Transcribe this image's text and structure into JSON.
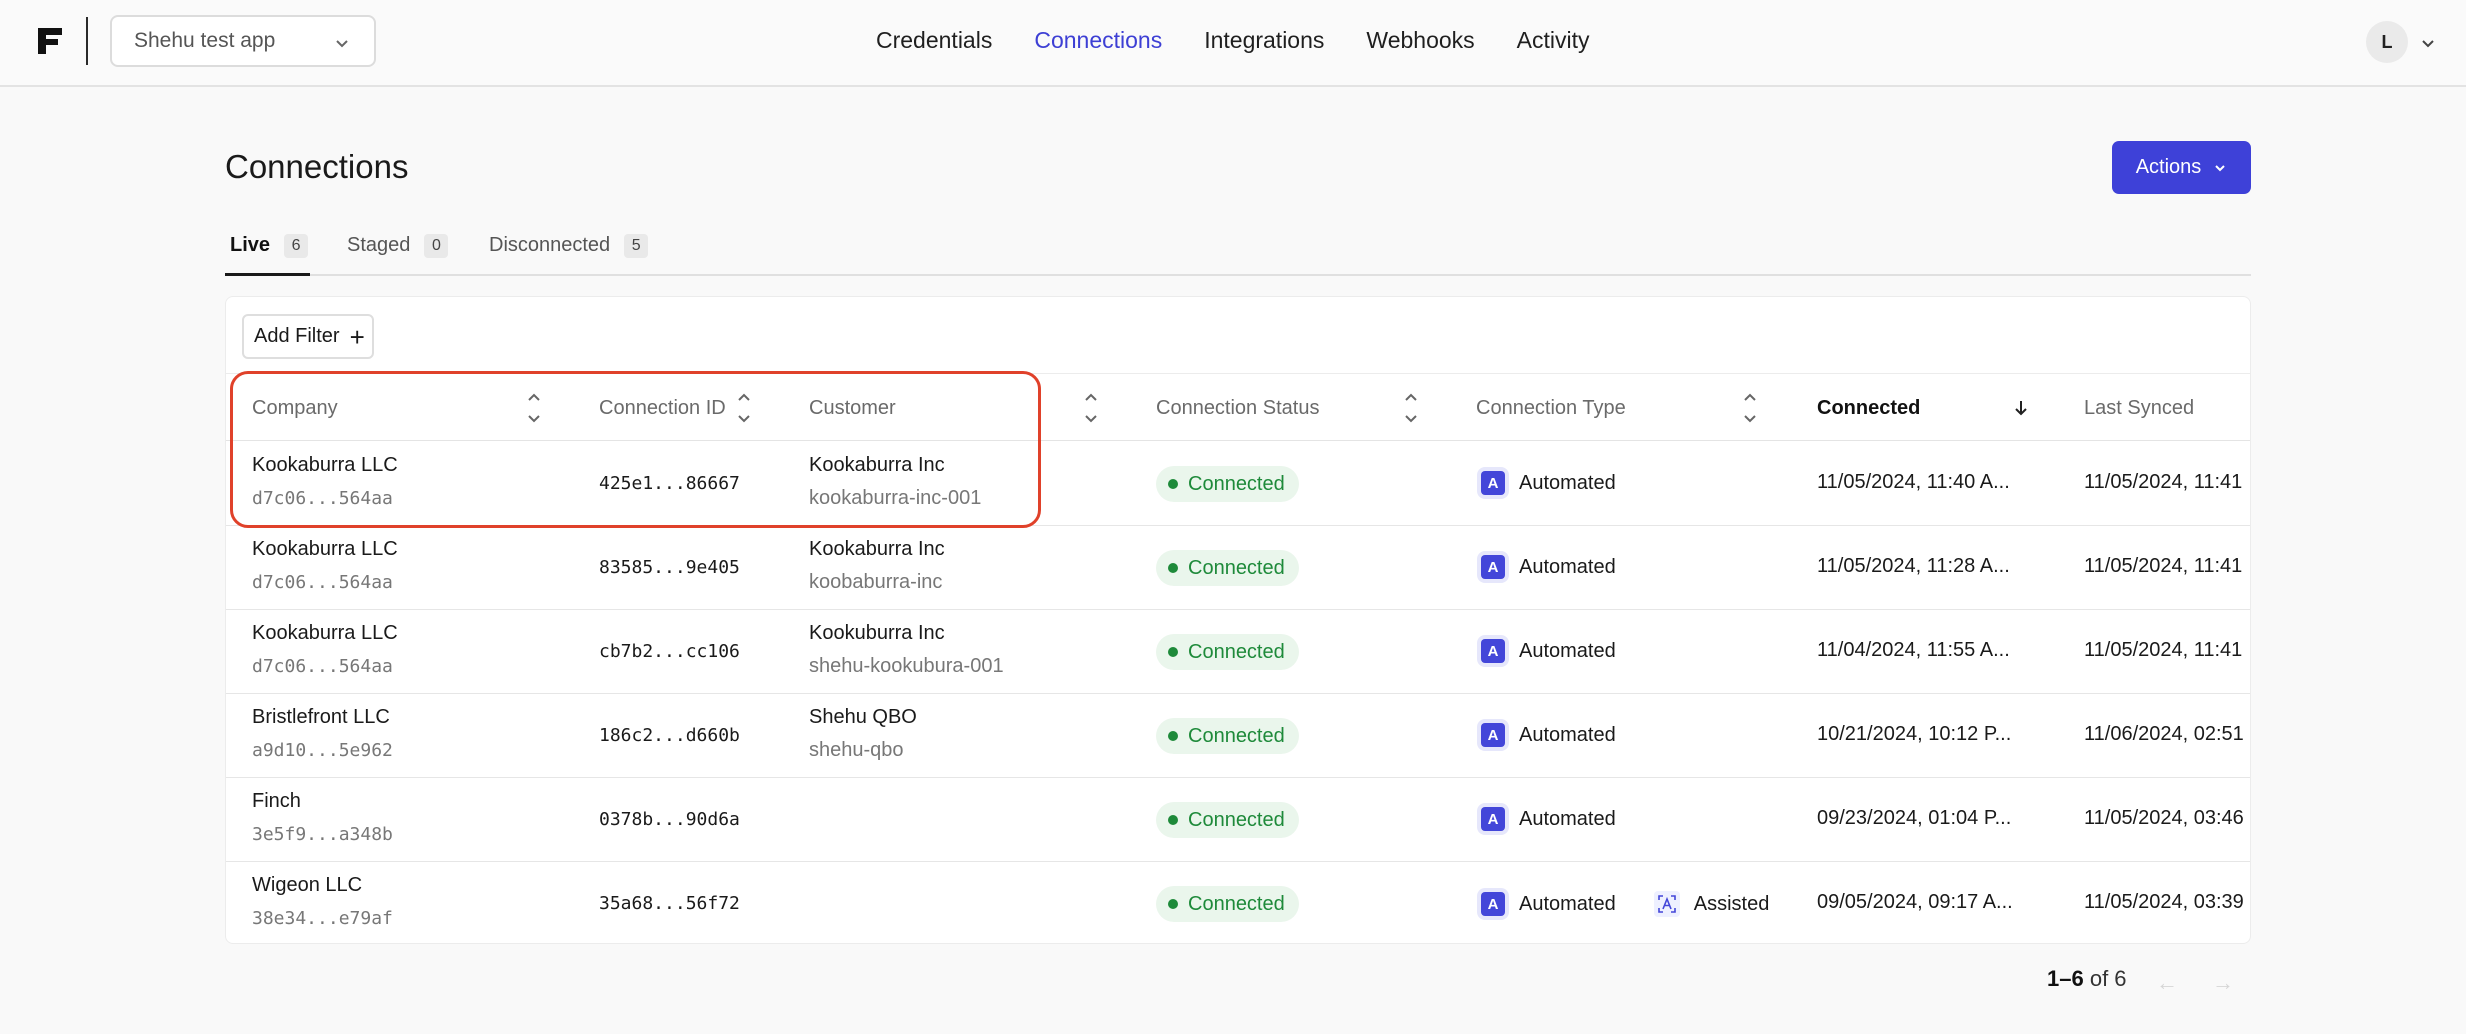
{
  "header": {
    "app_selector": "Shehu test app",
    "nav": [
      "Credentials",
      "Connections",
      "Integrations",
      "Webhooks",
      "Activity"
    ],
    "active_nav": "Connections",
    "avatar_initial": "L"
  },
  "page": {
    "title": "Connections",
    "actions_label": "Actions",
    "tabs": [
      {
        "label": "Live",
        "count": "6"
      },
      {
        "label": "Staged",
        "count": "0"
      },
      {
        "label": "Disconnected",
        "count": "5"
      }
    ],
    "add_filter_label": "Add Filter"
  },
  "table": {
    "columns": [
      "Company",
      "Connection ID",
      "Customer",
      "Connection Status",
      "Connection Type",
      "Connected",
      "Last Synced"
    ],
    "rows": [
      {
        "company": "Kookaburra LLC",
        "company_id": "d7c06...564aa",
        "connection_id": "425e1...86667",
        "customer": "Kookaburra Inc",
        "customer_id": "kookaburra-inc-001",
        "status": "Connected",
        "type": "Automated",
        "assisted": "",
        "connected": "11/05/2024, 11:40 A...",
        "last_synced": "11/05/2024, 11:41"
      },
      {
        "company": "Kookaburra LLC",
        "company_id": "d7c06...564aa",
        "connection_id": "83585...9e405",
        "customer": "Kookaburra Inc",
        "customer_id": "koobaburra-inc",
        "status": "Connected",
        "type": "Automated",
        "assisted": "",
        "connected": "11/05/2024, 11:28 A...",
        "last_synced": "11/05/2024, 11:41"
      },
      {
        "company": "Kookaburra LLC",
        "company_id": "d7c06...564aa",
        "connection_id": "cb7b2...cc106",
        "customer": "Kookuburra Inc",
        "customer_id": "shehu-kookubura-001",
        "status": "Connected",
        "type": "Automated",
        "assisted": "",
        "connected": "11/04/2024, 11:55 A...",
        "last_synced": "11/05/2024, 11:41"
      },
      {
        "company": "Bristlefront LLC",
        "company_id": "a9d10...5e962",
        "connection_id": "186c2...d660b",
        "customer": "Shehu QBO",
        "customer_id": "shehu-qbo",
        "status": "Connected",
        "type": "Automated",
        "assisted": "",
        "connected": "10/21/2024, 10:12 P...",
        "last_synced": "11/06/2024, 02:51"
      },
      {
        "company": "Finch",
        "company_id": "3e5f9...a348b",
        "connection_id": "0378b...90d6a",
        "customer": "",
        "customer_id": "",
        "status": "Connected",
        "type": "Automated",
        "assisted": "",
        "connected": "09/23/2024, 01:04 P...",
        "last_synced": "11/05/2024, 03:46"
      },
      {
        "company": "Wigeon LLC",
        "company_id": "38e34...e79af",
        "connection_id": "35a68...56f72",
        "customer": "",
        "customer_id": "",
        "status": "Connected",
        "type": "Automated",
        "assisted": "Assisted",
        "connected": "09/05/2024, 09:17 A...",
        "last_synced": "11/05/2024, 03:39"
      }
    ]
  },
  "pagination": {
    "range": "1–6",
    "of_label": "of 6"
  },
  "colors": {
    "accent": "#3e41d8",
    "status_green": "#1e8a3a",
    "highlight": "#e0412a"
  }
}
